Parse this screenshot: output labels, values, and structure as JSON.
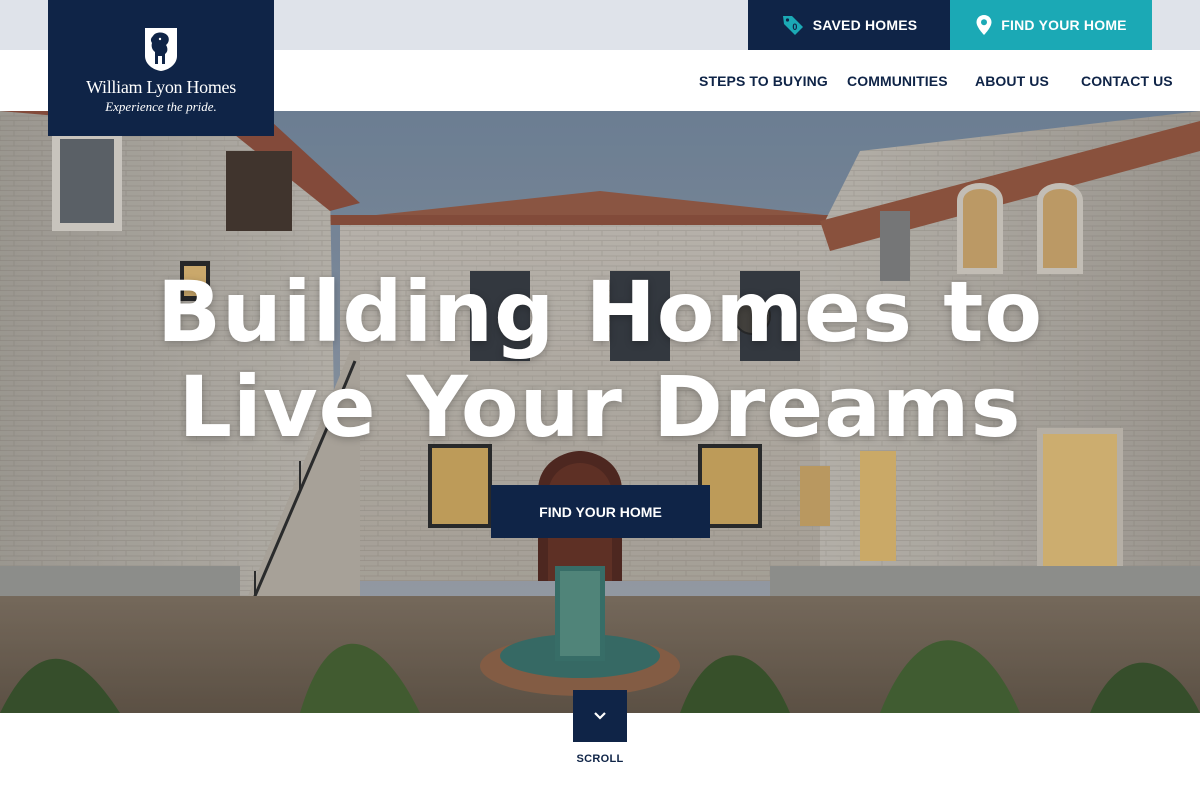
{
  "brand": {
    "name": "William Lyon Homes",
    "tagline": "Experience the pride.",
    "navy": "#0f2447",
    "teal": "#1ba9b5"
  },
  "utility": {
    "saved_homes": {
      "label": "SAVED HOMES",
      "icon": "tag-icon",
      "count": "0"
    },
    "find_home": {
      "label": "FIND YOUR HOME",
      "icon": "map-pin-icon"
    }
  },
  "nav": {
    "items": [
      {
        "label": "STEPS TO BUYING"
      },
      {
        "label": "COMMUNITIES"
      },
      {
        "label": "ABOUT US"
      },
      {
        "label": "CONTACT US"
      }
    ]
  },
  "hero": {
    "title_line1": "Building Homes to",
    "title_line2": "Live Your Dreams",
    "cta_label": "FIND YOUR HOME"
  },
  "scroll": {
    "label": "SCROLL",
    "icon": "chevron-down-icon"
  }
}
